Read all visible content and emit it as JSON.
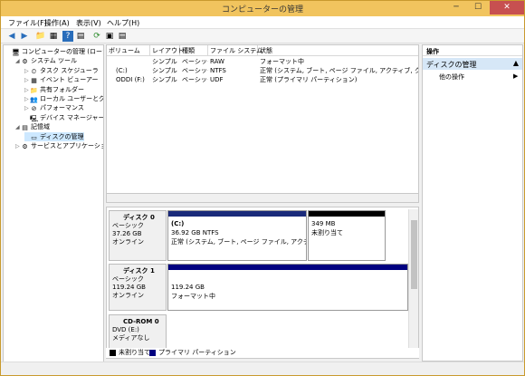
{
  "window": {
    "title": "コンピューターの管理",
    "min": "─",
    "max": "☐",
    "close": "✕"
  },
  "menu": [
    "ファイル(F)",
    "操作(A)",
    "表示(V)",
    "ヘルプ(H)"
  ],
  "toolbar": {
    "back": "◀",
    "forward": "▶",
    "icons": [
      "📁",
      "▦",
      "?",
      "▤",
      "⟳",
      "▣",
      "▤"
    ]
  },
  "tree": {
    "items": [
      {
        "label": "コンピューターの管理 (ローカル)",
        "indent": 0,
        "exp": "",
        "icon": "🖥"
      },
      {
        "label": "システム ツール",
        "indent": 1,
        "exp": "◢",
        "icon": "⚙"
      },
      {
        "label": "タスク スケジューラ",
        "indent": 2,
        "exp": "▷",
        "icon": "⏲"
      },
      {
        "label": "イベント ビューアー",
        "indent": 2,
        "exp": "▷",
        "icon": "▦"
      },
      {
        "label": "共有フォルダー",
        "indent": 2,
        "exp": "▷",
        "icon": "📁"
      },
      {
        "label": "ローカル ユーザーとグループ",
        "indent": 2,
        "exp": "▷",
        "icon": "👥"
      },
      {
        "label": "パフォーマンス",
        "indent": 2,
        "exp": "▷",
        "icon": "⊘"
      },
      {
        "label": "デバイス マネージャー",
        "indent": 2,
        "exp": "",
        "icon": "🖳"
      },
      {
        "label": "記憶域",
        "indent": 1,
        "exp": "◢",
        "icon": "▤"
      },
      {
        "label": "ディスクの管理",
        "indent": 2,
        "exp": "",
        "icon": "▭"
      },
      {
        "label": "サービスとアプリケーション",
        "indent": 1,
        "exp": "▷",
        "icon": "⚙"
      }
    ]
  },
  "volumes": {
    "headers": [
      "ボリューム",
      "レイアウト",
      "種類",
      "ファイル システム",
      "状態"
    ],
    "rows": [
      {
        "vol": "",
        "layout": "シンプル",
        "type": "ベーシック",
        "fs": "RAW",
        "status": "フォーマット中"
      },
      {
        "vol": "(C:)",
        "layout": "シンプル",
        "type": "ベーシック",
        "fs": "NTFS",
        "status": "正常 (システム, ブート, ページ ファイル, アクティブ, クラッシュ ダン"
      },
      {
        "vol": "ODDI (F:)",
        "layout": "シンプル",
        "type": "ベーシック",
        "fs": "UDF",
        "status": "正常 (プライマリ パーティション)"
      }
    ]
  },
  "disks": [
    {
      "name": "ディスク 0",
      "type": "ベーシック",
      "size": "37.26 GB",
      "state": "オンライン",
      "parts": [
        {
          "title": "(C:)",
          "line1": "36.92 GB NTFS",
          "line2": "正常 (システム, ブート, ページ ファイル, アクティブ, ク",
          "color": "#1a2a7a"
        },
        {
          "title": "",
          "line1": "349 MB",
          "line2": "未割り当て",
          "color": "#000000"
        }
      ]
    },
    {
      "name": "ディスク 1",
      "type": "ベーシック",
      "size": "119.24 GB",
      "state": "オンライン",
      "parts": [
        {
          "title": "",
          "line1": "119.24 GB",
          "line2": "フォーマット中",
          "color": "#000080"
        }
      ]
    },
    {
      "name": "CD-ROM 0",
      "type": "DVD (E:)",
      "size": "",
      "state": "メディアなし",
      "parts": []
    }
  ],
  "legend": [
    {
      "label": "未割り当て",
      "color": "#000000"
    },
    {
      "label": "プライマリ パーティション",
      "color": "#000080"
    }
  ],
  "actions": {
    "header": "操作",
    "section": "ディスクの管理",
    "more": "他の操作",
    "section_arrow": "▲",
    "more_arrow": "▶"
  }
}
